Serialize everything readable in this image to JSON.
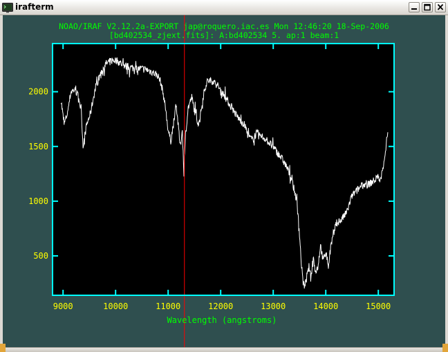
{
  "window": {
    "title": "irafterm"
  },
  "plot_header": {
    "line1": "NOAO/IRAF V2.12.2a-EXPORT jap@roquero.iac.es Mon 12:46:20 18-Sep-2006",
    "line2": "[bd402534_zjext.fits]: A:bd402534 5. ap:1 beam:1"
  },
  "colors": {
    "terminal_bg": "#2f4f4f",
    "frame": "#00ffff",
    "text": "#00ff00",
    "tick_labels": "#ffff00",
    "spectrum": "#ffffff",
    "plot_bg": "#000000",
    "cursor": "#ff0000"
  },
  "chart_data": {
    "type": "line",
    "title": "",
    "xlabel": "Wavelength (angstroms)",
    "ylabel": "",
    "xlim": [
      8800,
      15300
    ],
    "ylim": [
      140,
      2440
    ],
    "xticks": [
      9000,
      10000,
      11000,
      12000,
      13000,
      14000,
      15000
    ],
    "yticks": [
      500,
      1000,
      1500,
      2000
    ],
    "cursor_x": 11310,
    "series": [
      {
        "x": [
          8960,
          9020,
          9080,
          9150,
          9220,
          9300,
          9350,
          9380,
          9450,
          9520,
          9600,
          9700,
          9800,
          9900,
          10000,
          10100,
          10200,
          10300,
          10400,
          10500,
          10600,
          10700,
          10800,
          10850,
          10900,
          10950,
          11000,
          11050,
          11100,
          11150,
          11200,
          11230,
          11270,
          11300,
          11330,
          11380,
          11450,
          11500,
          11580,
          11620,
          11680,
          11750,
          11850,
          11950,
          12050,
          12150,
          12250,
          12350,
          12450,
          12520,
          12600,
          12680,
          12750,
          12850,
          12950,
          13050,
          13150,
          13250,
          13350,
          13450,
          13500,
          13540,
          13570,
          13600,
          13640,
          13680,
          13720,
          13760,
          13800,
          13850,
          13900,
          13950,
          14000,
          14050,
          14100,
          14150,
          14200,
          14300,
          14400,
          14500,
          14600,
          14700,
          14800,
          14900,
          15000,
          15050,
          15100,
          15150,
          15180
        ],
        "y": [
          1930,
          1700,
          1800,
          2000,
          2020,
          1950,
          1800,
          1500,
          1700,
          1800,
          2000,
          2150,
          2250,
          2280,
          2290,
          2260,
          2230,
          2220,
          2210,
          2210,
          2200,
          2180,
          2150,
          2100,
          2000,
          1850,
          1650,
          1550,
          1700,
          1900,
          1650,
          1500,
          1650,
          1230,
          1600,
          1850,
          1950,
          1830,
          1700,
          1800,
          2000,
          2100,
          2100,
          2050,
          1980,
          1900,
          1820,
          1750,
          1700,
          1600,
          1560,
          1620,
          1600,
          1570,
          1520,
          1460,
          1400,
          1320,
          1200,
          1000,
          700,
          400,
          260,
          220,
          300,
          400,
          300,
          500,
          350,
          400,
          600,
          450,
          550,
          400,
          600,
          700,
          800,
          830,
          900,
          1050,
          1100,
          1150,
          1150,
          1180,
          1220,
          1200,
          1350,
          1500,
          1630
        ]
      }
    ]
  }
}
